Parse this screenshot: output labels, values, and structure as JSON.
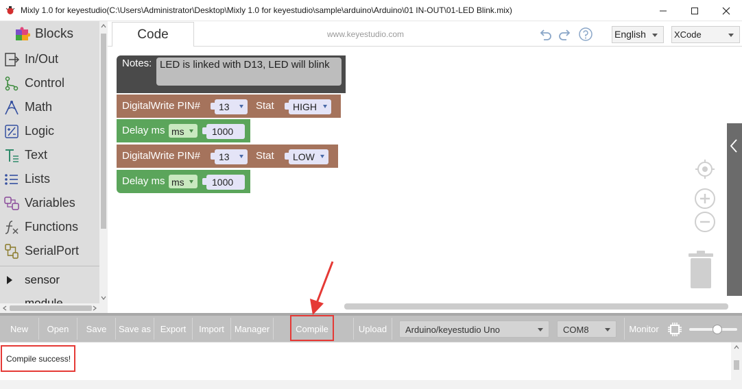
{
  "window": {
    "title": "Mixly 1.0 for keyestudio(C:\\Users\\Administrator\\Desktop\\Mixly 1.0 for keyestudio\\sample\\arduino\\Arduino\\01 IN-OUT\\01-LED Blink.mix)"
  },
  "sidebar": {
    "header": "Blocks",
    "categories": [
      {
        "label": "In/Out",
        "icon": "inout-icon"
      },
      {
        "label": "Control",
        "icon": "control-icon"
      },
      {
        "label": "Math",
        "icon": "math-icon"
      },
      {
        "label": "Logic",
        "icon": "logic-icon"
      },
      {
        "label": "Text",
        "icon": "text-icon"
      },
      {
        "label": "Lists",
        "icon": "lists-icon"
      },
      {
        "label": "Variables",
        "icon": "variables-icon"
      },
      {
        "label": "Functions",
        "icon": "functions-icon"
      },
      {
        "label": "SerialPort",
        "icon": "serialport-icon"
      }
    ],
    "tree": [
      {
        "label": "sensor"
      },
      {
        "label": "module"
      }
    ]
  },
  "header": {
    "tab_code": "Code",
    "site": "www.keyestudio.com",
    "language": "English",
    "theme": "XCode"
  },
  "blocks": {
    "notes_label": "Notes:",
    "notes_text": "LED is linked with D13, LED will blink",
    "dw1": {
      "label": "DigitalWrite PIN#",
      "pin": "13",
      "stat_label": "Stat",
      "stat": "HIGH"
    },
    "delay1": {
      "label": "Delay ms",
      "unit": "ms",
      "value": "1000"
    },
    "dw2": {
      "label": "DigitalWrite PIN#",
      "pin": "13",
      "stat_label": "Stat",
      "stat": "LOW"
    },
    "delay2": {
      "label": "Delay ms",
      "unit": "ms",
      "value": "1000"
    }
  },
  "toolbar": {
    "new": "New",
    "open": "Open",
    "save": "Save",
    "save_as": "Save as",
    "export": "Export",
    "import": "Import",
    "manager": "Manager",
    "compile": "Compile",
    "upload": "Upload",
    "board": "Arduino/keyestudio Uno",
    "port": "COM8",
    "monitor": "Monitor",
    "zoom_fraction": 0.6
  },
  "output": {
    "message": "Compile success!"
  },
  "colors": {
    "notes_block": "#4a4a4a",
    "digitalwrite_block": "#a5735c",
    "delay_block": "#5ba55b",
    "annotation": "#e53935"
  }
}
